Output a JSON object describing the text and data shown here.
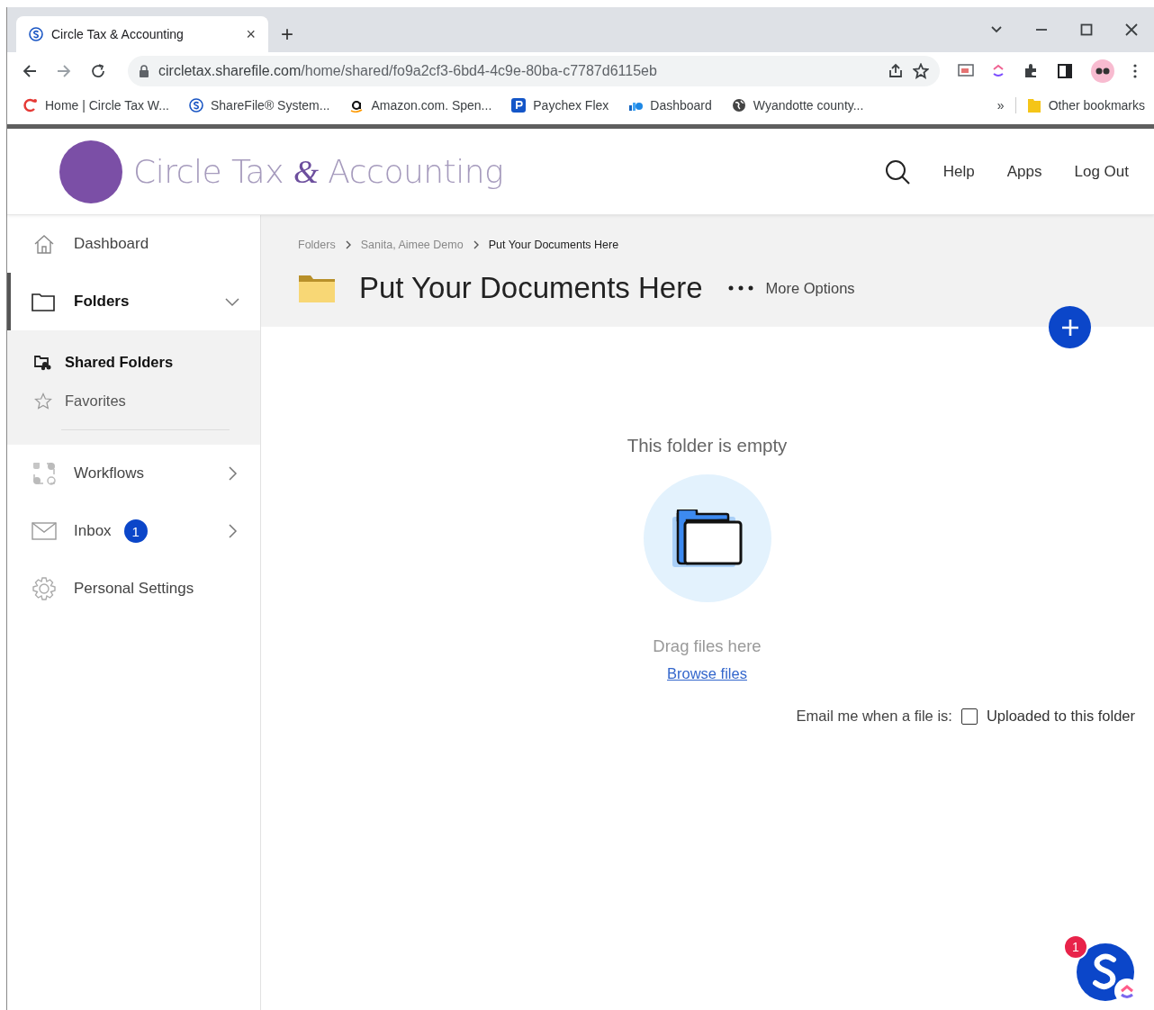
{
  "browser": {
    "tab": {
      "title": "Circle Tax & Accounting",
      "close": "×"
    },
    "new_tab": "+",
    "url": {
      "host": "circletax.sharefile.com",
      "path": "/home/shared/fo9a2cf3-6bd4-4c9e-80ba-c7787d6115eb"
    },
    "bookmarks": [
      {
        "label": "Home | Circle Tax W...",
        "kind": "circle"
      },
      {
        "label": "ShareFile® System...",
        "kind": "sharefile"
      },
      {
        "label": "Amazon.com. Spen...",
        "kind": "amazon"
      },
      {
        "label": "Paychex Flex",
        "kind": "paychex"
      },
      {
        "label": "Dashboard",
        "kind": "dashboard"
      },
      {
        "label": "Wyandotte county...",
        "kind": "globe"
      }
    ],
    "overflow": "»",
    "other_bookmarks": "Other bookmarks"
  },
  "header": {
    "logo": {
      "first": "Circle Tax",
      "amp": "&",
      "last": "Accounting"
    },
    "links": [
      "Help",
      "Apps",
      "Log Out"
    ]
  },
  "sidebar": {
    "items": [
      {
        "label": "Dashboard",
        "kind": "home",
        "selected": false
      },
      {
        "label": "Folders",
        "kind": "folder",
        "selected": true,
        "expanded": true,
        "children": [
          {
            "label": "Shared Folders",
            "kind": "shared",
            "selected": true
          },
          {
            "label": "Favorites",
            "kind": "star",
            "selected": false
          }
        ]
      },
      {
        "label": "Workflows",
        "kind": "workflow",
        "selected": false,
        "expanded": false
      },
      {
        "label": "Inbox",
        "kind": "mail",
        "selected": false,
        "expanded": false,
        "badge": "1"
      },
      {
        "label": "Personal Settings",
        "kind": "gear",
        "selected": false
      }
    ]
  },
  "breadcrumb": [
    "Folders",
    "Sanita, Aimee Demo",
    "Put Your Documents Here"
  ],
  "folder": {
    "title": "Put Your Documents Here",
    "more_options": "More Options"
  },
  "empty_state": {
    "message": "This folder is empty",
    "drag": "Drag files here",
    "browse": "Browse files"
  },
  "notify": {
    "label": "Email me when a file is:",
    "option": "Uploaded to this folder",
    "checked": false
  },
  "chat": {
    "badge": "1"
  }
}
